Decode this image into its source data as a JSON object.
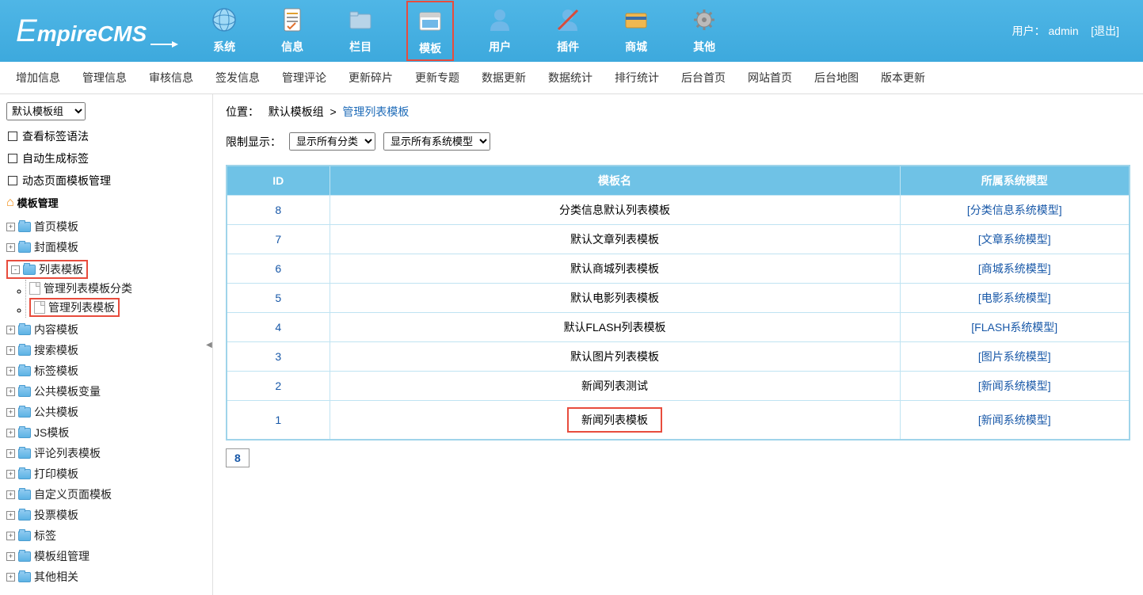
{
  "header": {
    "logo": "EmpireCMS",
    "menu": [
      {
        "label": "系统",
        "icon": "globe"
      },
      {
        "label": "信息",
        "icon": "doc"
      },
      {
        "label": "栏目",
        "icon": "folder"
      },
      {
        "label": "模板",
        "icon": "window",
        "active": true
      },
      {
        "label": "用户",
        "icon": "user"
      },
      {
        "label": "插件",
        "icon": "tool"
      },
      {
        "label": "商城",
        "icon": "card"
      },
      {
        "label": "其他",
        "icon": "gear"
      }
    ],
    "user_label": "用户：",
    "user_name": "admin",
    "logout": "[退出]"
  },
  "subnav": [
    "增加信息",
    "管理信息",
    "审核信息",
    "签发信息",
    "管理评论",
    "更新碎片",
    "更新专题",
    "数据更新",
    "数据统计",
    "排行统计",
    "后台首页",
    "网站首页",
    "后台地图",
    "版本更新"
  ],
  "sidebar": {
    "group_select": "默认模板组",
    "quick": [
      "查看标签语法",
      "自动生成标签",
      "动态页面模板管理"
    ],
    "section_title": "模板管理",
    "tree": [
      {
        "label": "首页模板",
        "exp": "+"
      },
      {
        "label": "封面模板",
        "exp": "+"
      },
      {
        "label": "列表模板",
        "exp": "-",
        "hl": true,
        "children": [
          {
            "label": "管理列表模板分类",
            "file": true
          },
          {
            "label": "管理列表模板",
            "file": true,
            "hl": true
          }
        ]
      },
      {
        "label": "内容模板",
        "exp": "+"
      },
      {
        "label": "搜索模板",
        "exp": "+"
      },
      {
        "label": "标签模板",
        "exp": "+"
      },
      {
        "label": "公共模板变量",
        "exp": "+"
      },
      {
        "label": "公共模板",
        "exp": "+"
      },
      {
        "label": "JS模板",
        "exp": "+"
      },
      {
        "label": "评论列表模板",
        "exp": "+"
      },
      {
        "label": "打印模板",
        "exp": "+"
      },
      {
        "label": "自定义页面模板",
        "exp": "+"
      },
      {
        "label": "投票模板",
        "exp": "+"
      },
      {
        "label": "标签",
        "exp": "+"
      },
      {
        "label": "模板组管理",
        "exp": "+"
      },
      {
        "label": "其他相关",
        "exp": "+"
      }
    ]
  },
  "main": {
    "bc_label": "位置：",
    "bc_group": "默认模板组",
    "bc_sep": ">",
    "bc_page": "管理列表模板",
    "filter_label": "限制显示：",
    "filter_cat": "显示所有分类",
    "filter_model": "显示所有系统模型",
    "cols": {
      "id": "ID",
      "name": "模板名",
      "model": "所属系统模型"
    },
    "rows": [
      {
        "id": "8",
        "name": "分类信息默认列表模板",
        "model": "[分类信息系统模型]"
      },
      {
        "id": "7",
        "name": "默认文章列表模板",
        "model": "[文章系统模型]"
      },
      {
        "id": "6",
        "name": "默认商城列表模板",
        "model": "[商城系统模型]"
      },
      {
        "id": "5",
        "name": "默认电影列表模板",
        "model": "[电影系统模型]"
      },
      {
        "id": "4",
        "name": "默认FLASH列表模板",
        "model": "[FLASH系统模型]"
      },
      {
        "id": "3",
        "name": "默认图片列表模板",
        "model": "[图片系统模型]"
      },
      {
        "id": "2",
        "name": "新闻列表测试",
        "model": "[新闻系统模型]"
      },
      {
        "id": "1",
        "name": "新闻列表模板",
        "model": "[新闻系统模型]",
        "hl": true
      }
    ],
    "pager": "8"
  }
}
